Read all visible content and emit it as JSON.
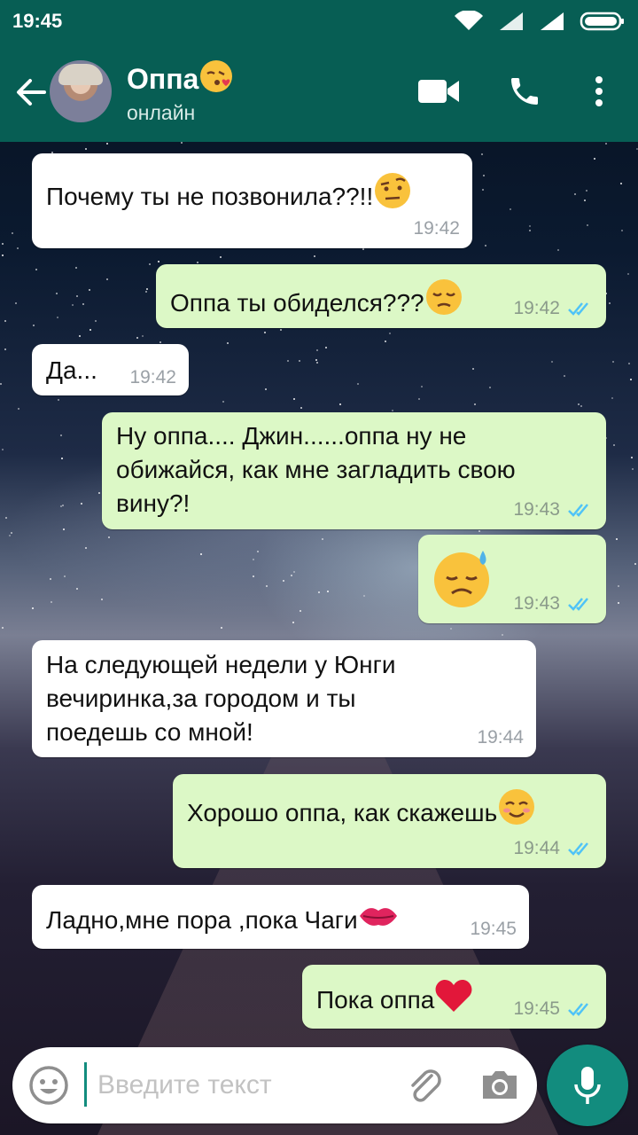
{
  "status_bar": {
    "time": "19:45"
  },
  "header": {
    "contact_name": "Оппа",
    "contact_status": "онлайн"
  },
  "messages": [
    {
      "direction": "in",
      "text": "Почему ты не позвонила??!!",
      "emoji": "face-with-raised-eyebrow",
      "time": "19:42"
    },
    {
      "direction": "out",
      "text": "Оппа ты обиделся???",
      "emoji": "pensive-face",
      "time": "19:42",
      "read": true
    },
    {
      "direction": "in",
      "text": "Да...",
      "time": "19:42"
    },
    {
      "direction": "out",
      "lines": [
        "Ну оппа.... Джин......оппа ну не",
        "обижайся, как мне загладить свою",
        "вину?!"
      ],
      "time": "19:43",
      "read": true
    },
    {
      "direction": "out",
      "emoji": "sad-but-relieved-face",
      "time": "19:43",
      "read": true
    },
    {
      "direction": "in",
      "lines": [
        "На следующей недели у Юнги",
        "вечиринка,за городом и ты",
        "поедешь со мной!"
      ],
      "time": "19:44"
    },
    {
      "direction": "out",
      "text": "Хорошо оппа, как скажешь",
      "emoji": "smiling-face",
      "time": "19:44",
      "read": true
    },
    {
      "direction": "in",
      "text": "Ладно,мне пора ,пока Чаги",
      "emoji": "kiss-mark",
      "time": "19:45"
    },
    {
      "direction": "out",
      "text": "Пока оппа",
      "emoji": "red-heart",
      "time": "19:45",
      "read": true
    }
  ],
  "composer": {
    "placeholder": "Введите текст"
  },
  "colors": {
    "header": "#075e54",
    "outgoing": "#dcf8c6",
    "incoming": "#ffffff",
    "accent": "#128c7e",
    "read_tick": "#4fc3f7"
  },
  "icons": [
    "back-arrow-icon",
    "video-call-icon",
    "phone-icon",
    "more-vert-icon",
    "emoji-icon",
    "attach-icon",
    "camera-icon",
    "mic-icon"
  ]
}
